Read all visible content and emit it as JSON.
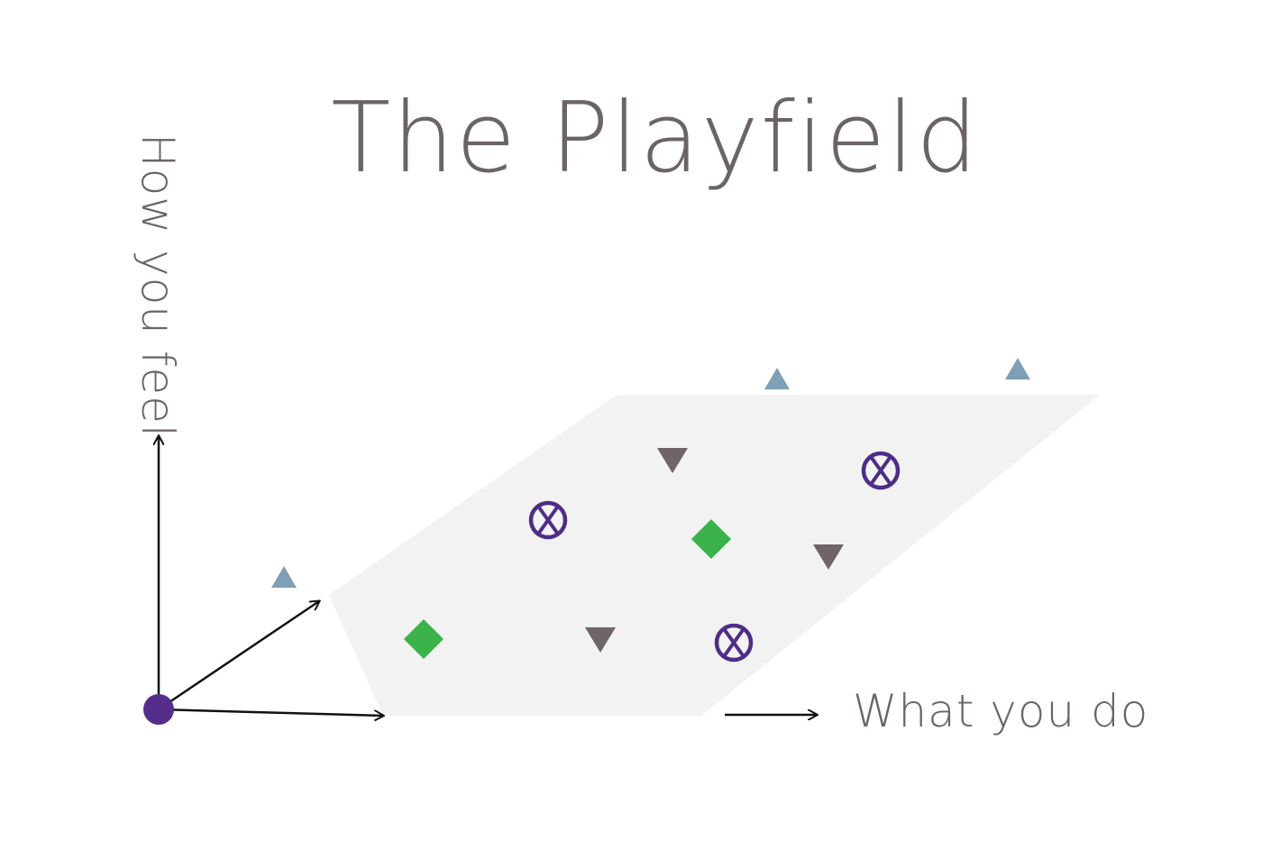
{
  "title": "The Playfield",
  "axes": {
    "vertical_label": "How you feel",
    "horizontal_label": "What you do"
  },
  "colors": {
    "plane": "#f2f2f2",
    "text": "#6b6367",
    "arrow": "#111111",
    "origin": "#532e8a",
    "triangle_up": "#7f9fb5",
    "triangle_down": "#6f6466",
    "diamond": "#3bb24a",
    "circle_x": "#4e2d86"
  },
  "markers": [
    {
      "kind": "triangle-up",
      "name": "triangle-up-marker"
    },
    {
      "kind": "triangle-up",
      "name": "triangle-up-marker"
    },
    {
      "kind": "triangle-up",
      "name": "triangle-up-marker"
    },
    {
      "kind": "triangle-down",
      "name": "triangle-down-marker"
    },
    {
      "kind": "triangle-down",
      "name": "triangle-down-marker"
    },
    {
      "kind": "triangle-down",
      "name": "triangle-down-marker"
    },
    {
      "kind": "diamond",
      "name": "diamond-marker"
    },
    {
      "kind": "diamond",
      "name": "diamond-marker"
    },
    {
      "kind": "circle-x",
      "name": "circle-x-marker"
    },
    {
      "kind": "circle-x",
      "name": "circle-x-marker"
    },
    {
      "kind": "circle-x",
      "name": "circle-x-marker"
    }
  ]
}
